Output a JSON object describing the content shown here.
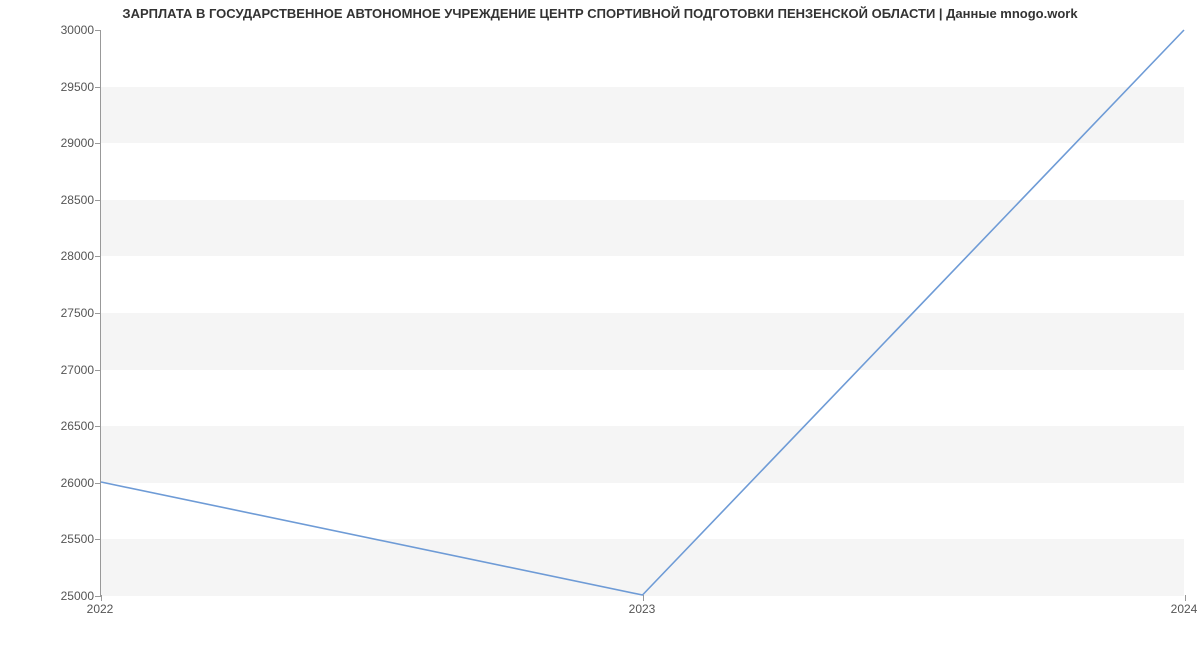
{
  "chart_data": {
    "type": "line",
    "title": "ЗАРПЛАТА В ГОСУДАРСТВЕННОЕ АВТОНОМНОЕ УЧРЕЖДЕНИЕ ЦЕНТР СПОРТИВНОЙ ПОДГОТОВКИ ПЕНЗЕНСКОЙ ОБЛАСТИ | Данные mnogo.work",
    "xlabel": "",
    "ylabel": "",
    "x": [
      "2022",
      "2023",
      "2024"
    ],
    "values": [
      26000,
      25000,
      30000
    ],
    "ylim": [
      25000,
      30000
    ],
    "yticks": [
      25000,
      25500,
      26000,
      26500,
      27000,
      27500,
      28000,
      28500,
      29000,
      29500,
      30000
    ],
    "line_color": "#6e9bd6"
  }
}
